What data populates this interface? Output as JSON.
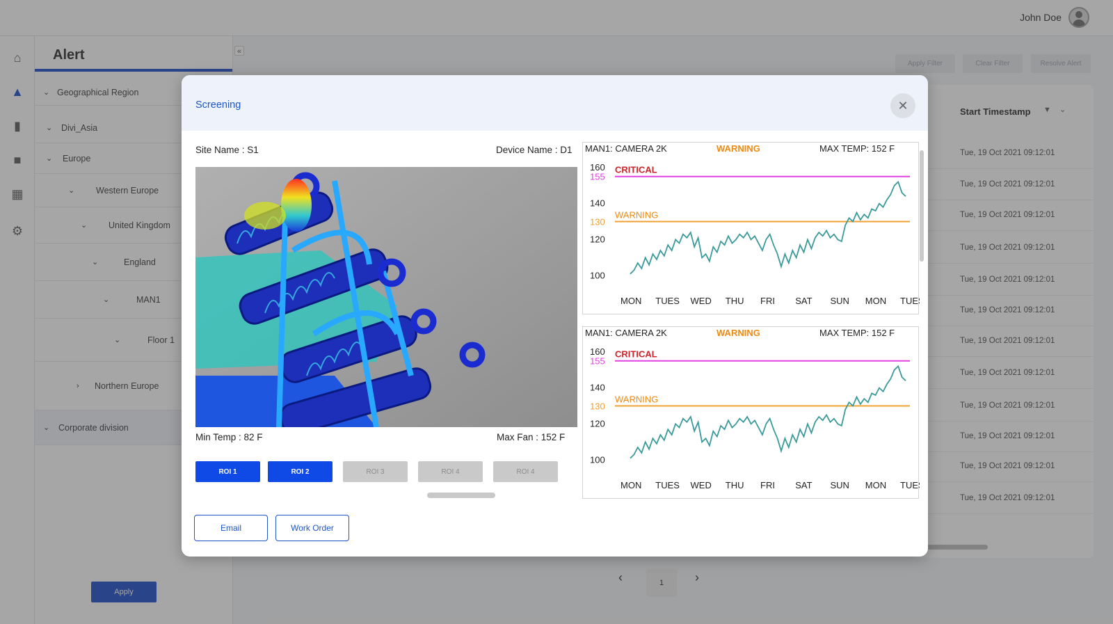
{
  "user": {
    "name": "John Doe"
  },
  "sidebar": {
    "title": "Alert",
    "tree": [
      {
        "label": "Geographical Region"
      },
      {
        "label": "Divi_Asia"
      },
      {
        "label": "Europe"
      },
      {
        "label": "Western Europe"
      },
      {
        "label": "United Kingdom"
      },
      {
        "label": "England"
      },
      {
        "label": "MAN1"
      },
      {
        "label": "Floor 1"
      },
      {
        "label": "Northern Europe"
      },
      {
        "label": "Corporate division"
      }
    ],
    "apply_label": "Apply"
  },
  "filters": {
    "apply": "Apply Filter",
    "clear": "Clear Filter",
    "resolve": "Resolve Alert"
  },
  "table": {
    "header": "Start Timestamp",
    "rows": [
      "Tue, 19 Oct 2021 09:12:01",
      "Tue, 19 Oct 2021 09:12:01",
      "Tue, 19 Oct 2021 09:12:01",
      "Tue, 19 Oct 2021 09:12:01",
      "Tue, 19 Oct 2021 09:12:01",
      "Tue, 19 Oct 2021 09:12:01",
      "Tue, 19 Oct 2021 09:12:01",
      "Tue, 19 Oct 2021 09:12:01",
      "Tue, 19 Oct 2021 09:12:01",
      "Tue, 19 Oct 2021 09:12:01",
      "Tue, 19 Oct 2021 09:12:01",
      "Tue, 19 Oct 2021 09:12:01"
    ]
  },
  "pagination": {
    "current": "1"
  },
  "modal": {
    "title": "Screening",
    "site_name": "Site Name : S1",
    "device_name": "Device Name : D1",
    "min_temp": "Min Temp : 82 F",
    "max_fan": "Max Fan : 152 F",
    "roi_buttons": [
      {
        "label": "ROI 1",
        "active": true
      },
      {
        "label": "ROI 2",
        "active": true
      },
      {
        "label": "ROI 3",
        "active": false
      },
      {
        "label": "ROI 4",
        "active": false
      },
      {
        "label": "ROI 4",
        "active": false
      }
    ],
    "email_label": "Email",
    "work_order_label": "Work Order"
  },
  "colors": {
    "accent": "#1143c8",
    "critical_line": "#e040e0",
    "warning_line": "#f0a030",
    "series_line": "#3a9a9a",
    "critical_text": "#d0202a",
    "warning_text": "#f08a10"
  },
  "chart_data": [
    {
      "type": "line",
      "title": "MAN1: CAMERA 2K",
      "status": "WARNING",
      "max_temp": "MAX TEMP: 152 F",
      "categories": [
        "MON",
        "TUES",
        "WED",
        "THU",
        "FRI",
        "SAT",
        "SUN",
        "MON",
        "TUES"
      ],
      "y_ticks": [
        100,
        120,
        140,
        160
      ],
      "ylim": [
        92,
        163
      ],
      "thresholds": [
        {
          "label": "CRITICAL",
          "value": 155,
          "value_label": "155"
        },
        {
          "label": "WARNING",
          "value": 130,
          "value_label": "130"
        }
      ],
      "values": [
        101,
        103,
        107,
        104,
        110,
        106,
        112,
        109,
        114,
        111,
        117,
        114,
        120,
        118,
        123,
        121,
        124,
        116,
        121,
        110,
        112,
        108,
        116,
        113,
        119,
        117,
        122,
        118,
        120,
        123,
        121,
        124,
        120,
        122,
        118,
        114,
        120,
        123,
        117,
        112,
        105,
        112,
        107,
        114,
        110,
        117,
        113,
        120,
        115,
        121,
        124,
        122,
        125,
        121,
        123,
        120,
        119,
        128,
        132,
        130,
        135,
        131,
        134,
        132,
        137,
        136,
        140,
        138,
        142,
        145,
        150,
        152,
        146,
        144
      ]
    },
    {
      "type": "line",
      "title": "MAN1: CAMERA 2K",
      "status": "WARNING",
      "max_temp": "MAX TEMP: 152 F",
      "categories": [
        "MON",
        "TUES",
        "WED",
        "THU",
        "FRI",
        "SAT",
        "SUN",
        "MON",
        "TUES"
      ],
      "y_ticks": [
        100,
        120,
        140,
        160
      ],
      "ylim": [
        92,
        163
      ],
      "thresholds": [
        {
          "label": "CRITICAL",
          "value": 155,
          "value_label": "155"
        },
        {
          "label": "WARNING",
          "value": 130,
          "value_label": "130"
        }
      ],
      "values": [
        101,
        103,
        107,
        104,
        110,
        106,
        112,
        109,
        114,
        111,
        117,
        114,
        120,
        118,
        123,
        121,
        124,
        116,
        121,
        110,
        112,
        108,
        116,
        113,
        119,
        117,
        122,
        118,
        120,
        123,
        121,
        124,
        120,
        122,
        118,
        114,
        120,
        123,
        117,
        112,
        105,
        112,
        107,
        114,
        110,
        117,
        113,
        120,
        115,
        121,
        124,
        122,
        125,
        121,
        123,
        120,
        119,
        128,
        132,
        130,
        135,
        131,
        134,
        132,
        137,
        136,
        140,
        138,
        142,
        145,
        150,
        152,
        146,
        144
      ]
    }
  ]
}
